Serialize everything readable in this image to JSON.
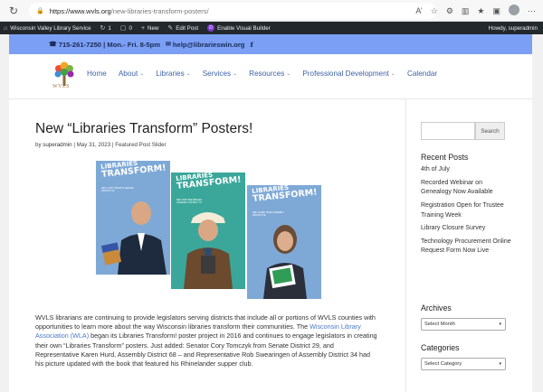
{
  "browser": {
    "url_host": "https://www.wvls.org",
    "url_path": "/new-libraries-transform-posters/",
    "read_aloud": "A’",
    "icons": [
      "back-icon",
      "refresh-icon",
      "lock-icon",
      "read-aloud-icon",
      "star-icon",
      "extensions-icon",
      "split-icon",
      "favorites-icon",
      "collections-icon",
      "profile-icon",
      "more-icon"
    ]
  },
  "admin_bar": {
    "site": "Wisconsin Valley Library Service",
    "updates": "1",
    "comments": "0",
    "new": "New",
    "edit": "Edit Post",
    "divi": "Enable Visual Builder",
    "howdy": "Howdy, superadmin"
  },
  "contact": {
    "phone": "715-261-7250 | Mon.- Fri. 8-5pm",
    "email": "help@librarieswin.org",
    "facebook": "f"
  },
  "logo": {
    "text": "WVLS"
  },
  "menu": [
    {
      "label": "Home",
      "dropdown": false
    },
    {
      "label": "About",
      "dropdown": true
    },
    {
      "label": "Libraries",
      "dropdown": true
    },
    {
      "label": "Services",
      "dropdown": true
    },
    {
      "label": "Resources",
      "dropdown": true
    },
    {
      "label": "Professional Development",
      "dropdown": true
    },
    {
      "label": "Calendar",
      "dropdown": false
    }
  ],
  "post": {
    "title": "New “Libraries Transform” Posters!",
    "meta_by": "by ",
    "author": "superadmin",
    "meta_sep1": " | ",
    "date": "May 31, 2023",
    "meta_sep2": " | ",
    "category": "Featured Post Slider",
    "body_pre": "WVLS librarians are continuing to provide legislators serving districts that include all or portions of WVLS counties with opportunities to learn more about the way Wisconsin libraries transform their communities. The ",
    "body_link": "Wisconsin Library Association (WLA)",
    "body_post": " began its Libraries Transform! poster project in 2016 and continues to engage legislators in creating their own “Libraries Transform” posters. Just added: Senator Cory Tomczyk from Senate District 29, and Representative Karen Hurd, Assembly District 68 – and Representative Rob Swearingen of Assembly District 34 had his picture updated with the book that featured his Rhinelander supper club."
  },
  "posters": [
    {
      "line1": "LIBRARIES",
      "line2": "TRANSFORM!",
      "bg": "#7ea9d6",
      "sub": "SEN. CORY TOMCZYK SENATE DISTRICT 29"
    },
    {
      "line1": "LIBRARIES",
      "line2": "TRANSFORM!",
      "bg": "#3aa79a",
      "sub": "REP. ROB SWEARINGEN ASSEMBLY DISTRICT 34"
    },
    {
      "line1": "LIBRARIES",
      "line2": "TRANSFORM!",
      "bg": "#7ea9d6",
      "sub": "REP. KAREN HURD ASSEMBLY DISTRICT 68"
    }
  ],
  "sidebar": {
    "search_button": "Search",
    "recent_heading": "Recent Posts",
    "recent_posts": [
      "4th of July",
      "Recorded Webinar on Genealogy Now Available",
      "Registration Open for Trustee Training Week",
      "Library Closure Survey",
      "Technology Procurement Online Request Form Now Live"
    ],
    "archives_heading": "Archives",
    "archives_select": "Select Month",
    "categories_heading": "Categories",
    "categories_select": "Select Category"
  }
}
